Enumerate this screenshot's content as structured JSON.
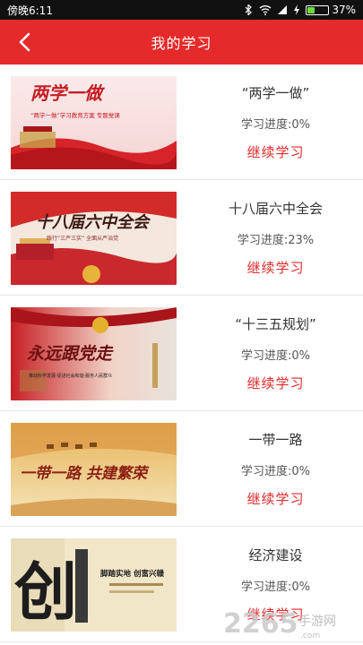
{
  "status": {
    "time": "傍晚6:11",
    "battery": "37%",
    "battery_level": 0.37
  },
  "header": {
    "title": "我的学习",
    "back_icon": "back-arrow-icon"
  },
  "continue_label": "继续学习",
  "courses": [
    {
      "title": "“两学一做”",
      "progress": "学习进度:0%",
      "thumb_text": "两学一做",
      "thumb_sub": "“两学一做”学习教育方案 专题党课"
    },
    {
      "title": "十八届六中全会",
      "progress": "学习进度:23%",
      "thumb_text": "十八届六中全会",
      "thumb_sub": "践行“三严三实” 全面从严治党"
    },
    {
      "title": "“十三五规划”",
      "progress": "学习进度:0%",
      "thumb_text": "永远跟党走",
      "thumb_sub": "推动科学发展·促进社会和谐·服务人民群众"
    },
    {
      "title": "一带一路",
      "progress": "学习进度:0%",
      "thumb_text": "一带一路 共建繁荣",
      "thumb_sub": ""
    },
    {
      "title": "经济建设",
      "progress": "学习进度:0%",
      "thumb_text": "创",
      "thumb_sub": "脚踏实地 创富兴赣"
    }
  ],
  "watermark": {
    "text": "2265",
    "suffix": "手游网",
    "domain": ".com"
  },
  "colors": {
    "accent": "#e42a2a"
  }
}
